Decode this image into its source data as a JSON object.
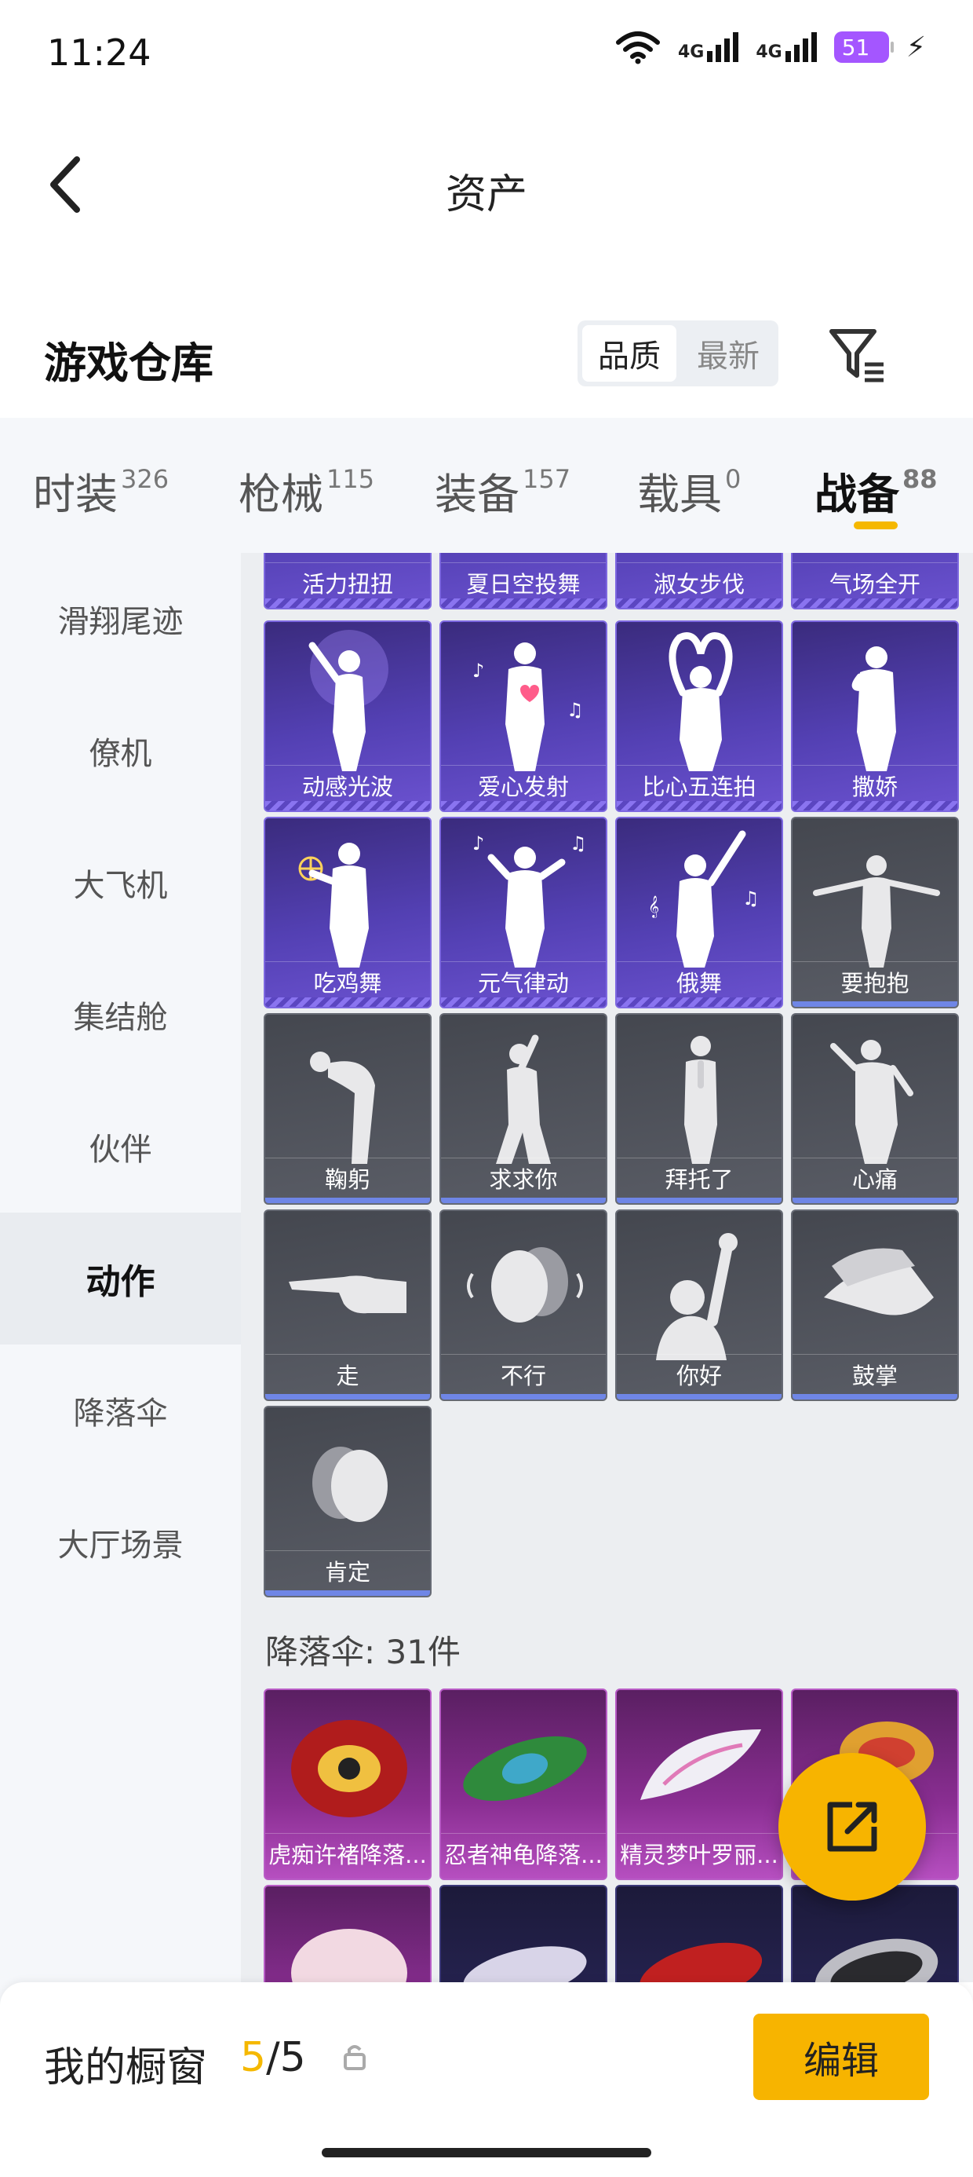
{
  "status": {
    "time": "11:24",
    "net1": "4G",
    "net2": "4G",
    "battery": "51"
  },
  "nav": {
    "title": "资产"
  },
  "header": {
    "title": "游戏仓库",
    "sort_quality": "品质",
    "sort_newest": "最新"
  },
  "tabs": [
    {
      "label": "时装",
      "count": "326"
    },
    {
      "label": "枪械",
      "count": "115"
    },
    {
      "label": "装备",
      "count": "157"
    },
    {
      "label": "载具",
      "count": "0"
    },
    {
      "label": "战备",
      "count": "88"
    }
  ],
  "sidebar": {
    "items": [
      {
        "label": "滑翔尾迹"
      },
      {
        "label": "僚机"
      },
      {
        "label": "大飞机"
      },
      {
        "label": "集结舱"
      },
      {
        "label": "伙伴"
      },
      {
        "label": "动作"
      },
      {
        "label": "降落伞"
      },
      {
        "label": "大厅场景"
      }
    ]
  },
  "emotes": [
    "活力扭扭",
    "夏日空投舞",
    "淑女步伐",
    "气场全开",
    "动感光波",
    "爱心发射",
    "比心五连拍",
    "撒娇",
    "吃鸡舞",
    "元气律动",
    "俄舞",
    "要抱抱",
    "鞠躬",
    "求求你",
    "拜托了",
    "心痛",
    "走",
    "不行",
    "你好",
    "鼓掌",
    "肯定"
  ],
  "parachute_section": "降落伞: 31件",
  "parachutes": [
    "虎痴许褚降落...",
    "忍者神龟降落...",
    "精灵梦叶罗丽...",
    ""
  ],
  "bottom": {
    "showcase_label": "我的橱窗",
    "count_current": "5",
    "count_total": "/5",
    "edit": "编辑"
  },
  "colors": {
    "accent": "#f7b400",
    "purple_card": "#5340b3",
    "gray_card": "#50535b"
  }
}
